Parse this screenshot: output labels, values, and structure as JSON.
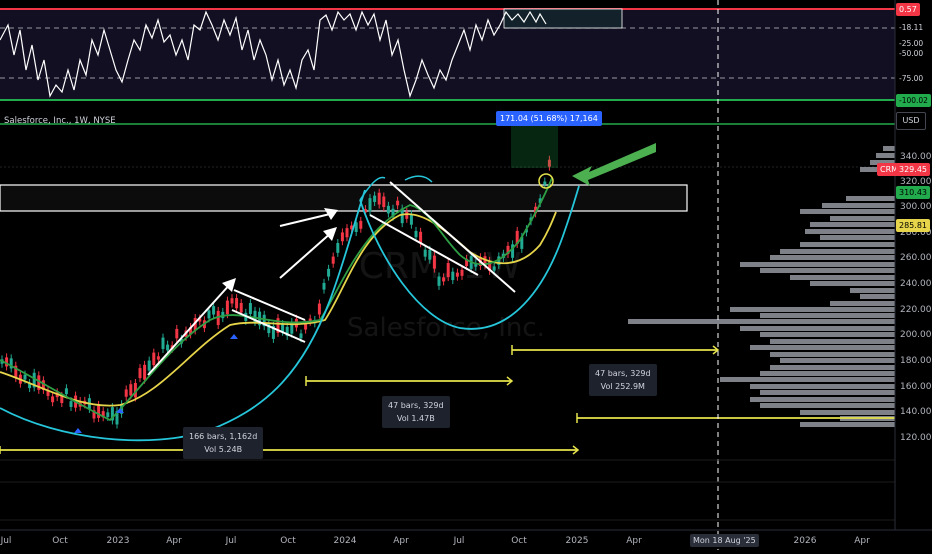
{
  "symbol": {
    "title": "Salesforce, Inc., 1W, NYSE",
    "watermark_ticker": "CRM, 1W",
    "watermark_name": "Salesforce, Inc."
  },
  "colors": {
    "background": "#000000",
    "rsi_line": "#ffffff",
    "rsi_top_line": "#f23645",
    "rsi_bottom_line": "#22ab4c",
    "ma_fast": "#2e9e44",
    "ma_slow": "#e6d44a",
    "channel": "#26c6da",
    "range_bar": "#e6e34c",
    "up_candle": "#22ab94",
    "down_candle": "#f23645",
    "volume_profile": "#9598a1"
  },
  "rsi_pane": {
    "price_labels": [
      "0.57",
      "-18.11",
      "-25.00",
      "-50.00",
      "-75.00",
      "-100.02"
    ]
  },
  "price_axis": {
    "unit_button": "USD",
    "ticks": [
      "340.00",
      "320.00",
      "300.00",
      "280.00",
      "260.00",
      "240.00",
      "220.00",
      "200.00",
      "180.00",
      "160.00",
      "140.00",
      "120.00"
    ],
    "current_price_badge": "329.45",
    "ticker_badge": "CRM",
    "badge_2": "310.43",
    "badge_3": "285.81"
  },
  "time_axis": {
    "labels": [
      "Jul",
      "Oct",
      "2023",
      "Apr",
      "Jul",
      "Oct",
      "2024",
      "Apr",
      "Jul",
      "Oct",
      "2025",
      "Apr",
      "Mon 18 Aug '25",
      "Oct",
      "2026",
      "Apr"
    ]
  },
  "measure_box": {
    "text": "171.04 (51.68%) 17,164"
  },
  "range_labels": [
    {
      "line1": "166 bars, 1,162d",
      "line2": "Vol 5.24B"
    },
    {
      "line1": "47 bars, 329d",
      "line2": "Vol 1.47B"
    },
    {
      "line1": "47 bars, 329d",
      "line2": "Vol 252.9M"
    }
  ]
}
